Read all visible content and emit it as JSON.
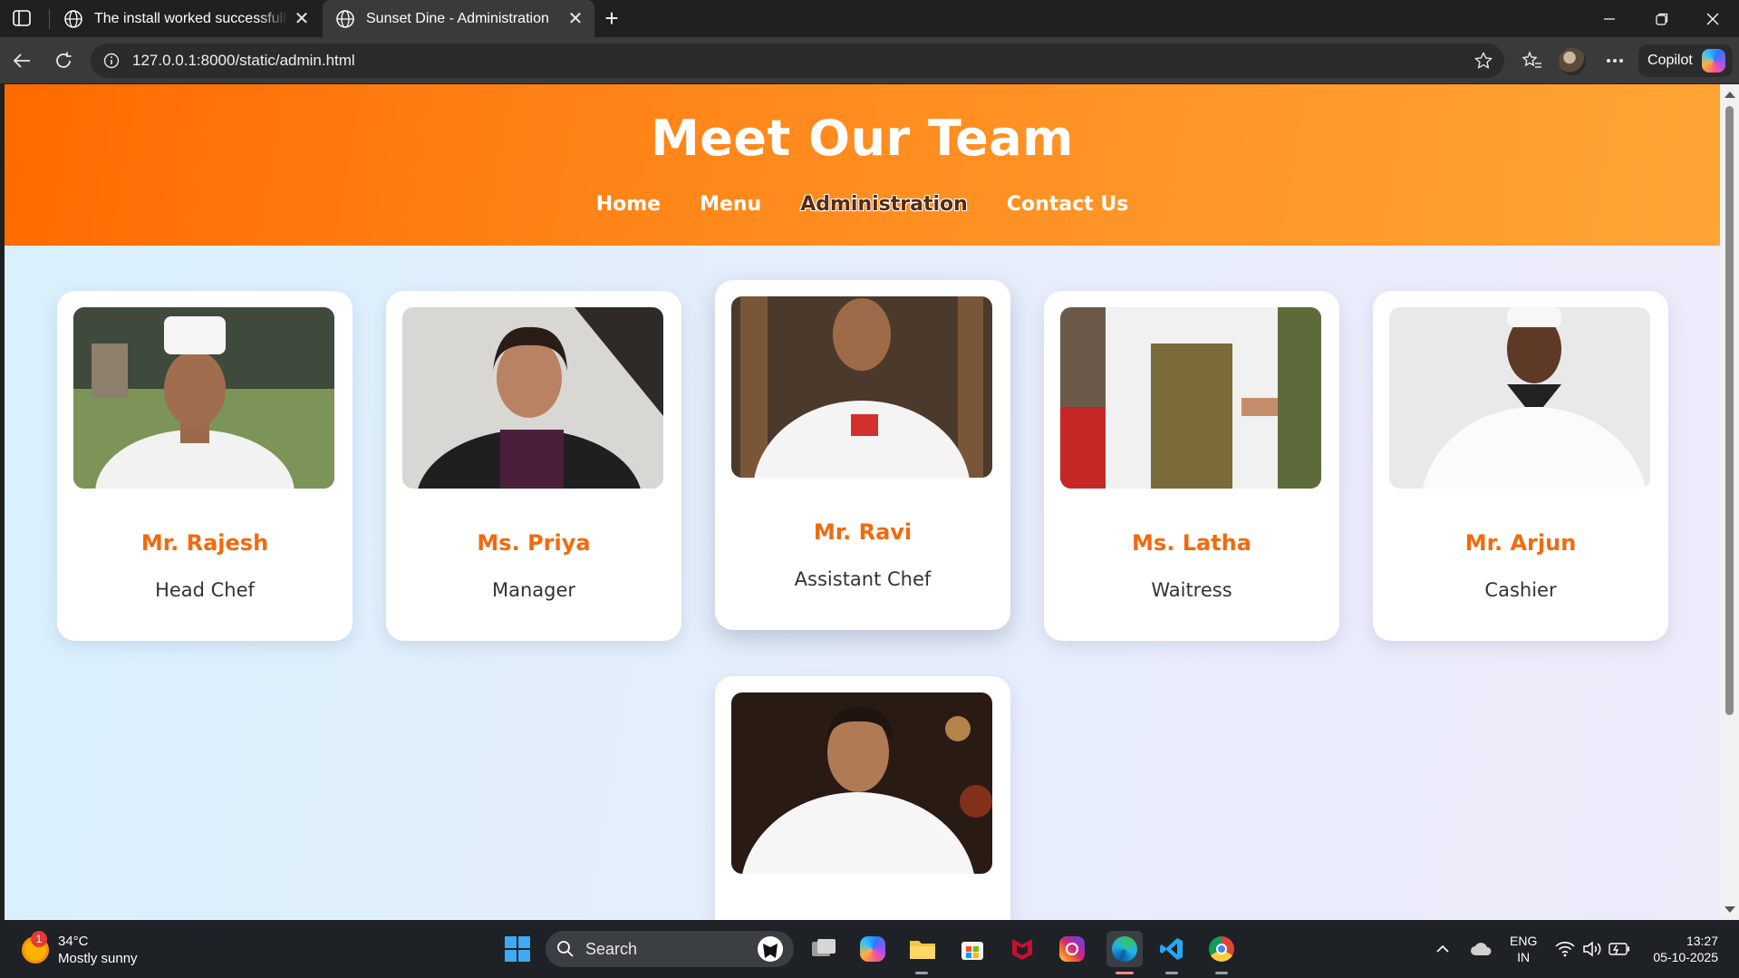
{
  "browser": {
    "tabs": [
      {
        "title": "The install worked successfully! Congratulations!",
        "active": false
      },
      {
        "title": "Sunset Dine - Administration",
        "active": true
      }
    ],
    "url": "127.0.0.1:8000/static/admin.html",
    "copilot_label": "Copilot"
  },
  "page": {
    "heading": "Meet Our Team",
    "nav": [
      {
        "label": "Home"
      },
      {
        "label": "Menu"
      },
      {
        "label": "Administration",
        "current": true
      },
      {
        "label": "Contact Us"
      }
    ],
    "team": [
      {
        "name": "Mr. Rajesh",
        "role": "Head Chef"
      },
      {
        "name": "Ms. Priya",
        "role": "Manager"
      },
      {
        "name": "Mr. Ravi",
        "role": "Assistant Chef"
      },
      {
        "name": "Ms. Latha",
        "role": "Waitress"
      },
      {
        "name": "Mr. Arjun",
        "role": "Cashier"
      },
      {
        "name": "",
        "role": ""
      }
    ],
    "colors": {
      "header_start": "#ff6a00",
      "header_end": "#ffa535",
      "name_text": "#f26a0d"
    }
  },
  "taskbar": {
    "weather_temp": "34°C",
    "weather_desc": "Mostly sunny",
    "weather_badge": "1",
    "search_label": "Search",
    "lang_line1": "ENG",
    "lang_line2": "IN",
    "time": "13:27",
    "date": "05-10-2025",
    "pinned_icons": [
      "task-view-icon",
      "copilot-app-icon",
      "file-explorer-icon",
      "microsoft-store-icon",
      "mcafee-icon",
      "instagram-icon",
      "edge-icon",
      "vscode-icon",
      "chrome-icon"
    ]
  }
}
